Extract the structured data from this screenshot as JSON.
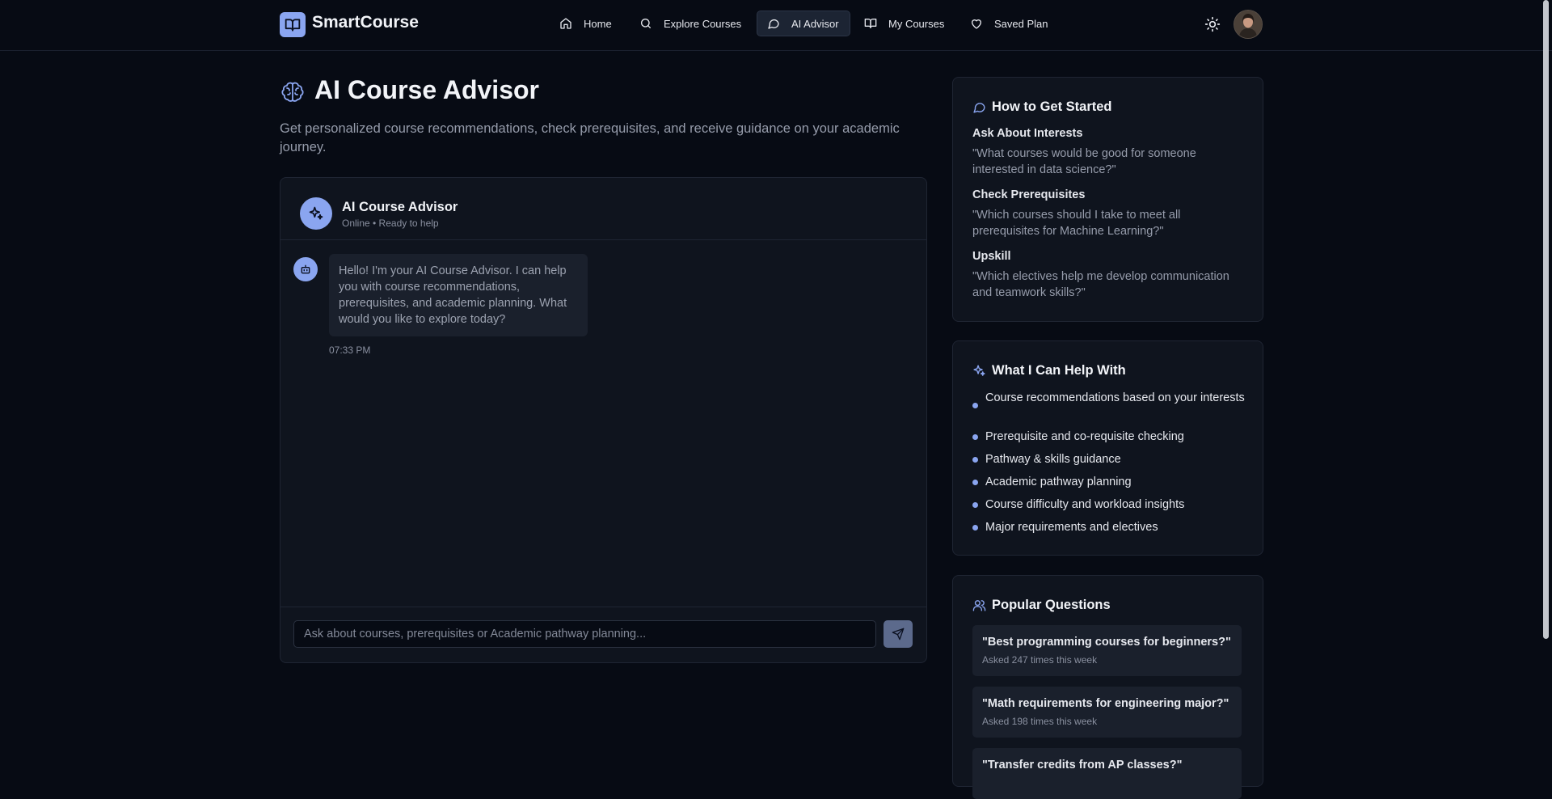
{
  "app": {
    "name": "SmartCourse"
  },
  "nav": {
    "home": "Home",
    "explore": "Explore Courses",
    "advisor": "AI Advisor",
    "my_courses": "My Courses",
    "saved_plan": "Saved Plan"
  },
  "page": {
    "title": "AI Course Advisor",
    "subtitle": "Get personalized course recommendations, check prerequisites, and receive guidance on your academic journey."
  },
  "chat": {
    "title": "AI Course Advisor",
    "status": "Online • Ready to help",
    "messages": [
      {
        "text": "Hello! I'm your AI Course Advisor. I can help you with course recommendations, prerequisites, and academic planning. What would you like to explore today?",
        "time": "07:33 PM"
      }
    ],
    "input_placeholder": "Ask about courses, prerequisites or Academic pathway planning..."
  },
  "get_started": {
    "title": "How to Get Started",
    "items": [
      {
        "title": "Ask About Interests",
        "text": "\"What courses would be good for someone interested in data science?\""
      },
      {
        "title": "Check Prerequisites",
        "text": "\"Which courses should I take to meet all prerequisites for Machine Learning?\""
      },
      {
        "title": "Upskill",
        "text": "\"Which electives help me develop communication and teamwork skills?\""
      }
    ]
  },
  "help": {
    "title": "What I Can Help With",
    "items": [
      "Course recommendations based on your interests",
      "Prerequisite and co-requisite checking",
      "Pathway & skills guidance",
      "Academic pathway planning",
      "Course difficulty and workload insights",
      "Major requirements and electives"
    ]
  },
  "popular": {
    "title": "Popular Questions",
    "items": [
      {
        "q": "\"Best programming courses for beginners?\"",
        "count": "Asked 247 times this week"
      },
      {
        "q": "\"Math requirements for engineering major?\"",
        "count": "Asked 198 times this week"
      },
      {
        "q": "\"Transfer credits from AP classes?\""
      }
    ]
  },
  "colors": {
    "background": "#070b14",
    "card": "#0f141e",
    "accent": "#8aa5f0"
  },
  "icons": {
    "logo": "book-open-icon",
    "home": "home-icon",
    "explore": "search-icon",
    "advisor": "chat-bubble-icon",
    "my_courses": "book-icon",
    "saved": "heart-icon",
    "theme": "sun-icon",
    "page": "brain-icon",
    "bot": "sparkles-icon",
    "message_avatar": "bot-icon",
    "send": "send-icon",
    "help": "sparkles-icon",
    "popular": "users-icon"
  }
}
